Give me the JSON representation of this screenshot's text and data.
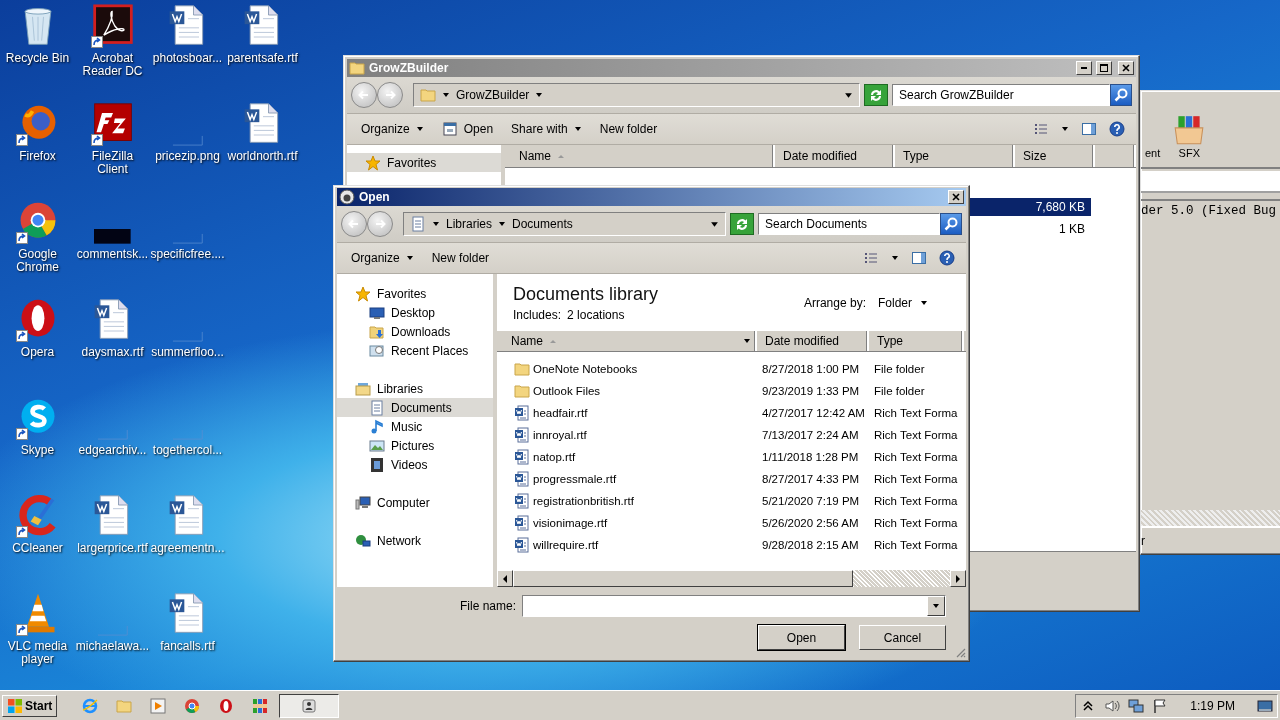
{
  "desktop_icons": [
    {
      "label": "Recycle Bin",
      "kind": "recycle",
      "shortcut": false
    },
    {
      "label": "Firefox",
      "kind": "firefox",
      "shortcut": true
    },
    {
      "label": "Google Chrome",
      "kind": "chrome",
      "shortcut": true
    },
    {
      "label": "Opera",
      "kind": "opera",
      "shortcut": true
    },
    {
      "label": "Skype",
      "kind": "skype",
      "shortcut": true
    },
    {
      "label": "CCleaner",
      "kind": "ccleaner",
      "shortcut": true
    },
    {
      "label": "VLC media player",
      "kind": "vlc",
      "shortcut": true
    },
    {
      "label": "Acrobat Reader DC",
      "kind": "acrobat",
      "shortcut": true
    },
    {
      "label": "FileZilla Client",
      "kind": "filezilla",
      "shortcut": true
    },
    {
      "label": "commentsk...",
      "kind": "black",
      "shortcut": false
    },
    {
      "label": "daysmax.rtf",
      "kind": "word",
      "shortcut": false
    },
    {
      "label": "edgearchiv...",
      "kind": "blank",
      "shortcut": false
    },
    {
      "label": "largerprice.rtf",
      "kind": "word",
      "shortcut": false
    },
    {
      "label": "michaelawa...",
      "kind": "blank",
      "shortcut": false
    },
    {
      "label": "photosboar...",
      "kind": "word",
      "shortcut": false
    },
    {
      "label": "pricezip.png",
      "kind": "blank",
      "shortcut": false
    },
    {
      "label": "specificfree....",
      "kind": "blank",
      "shortcut": false
    },
    {
      "label": "summerfloo...",
      "kind": "blank",
      "shortcut": false
    },
    {
      "label": "togethercol...",
      "kind": "blank",
      "shortcut": false
    },
    {
      "label": "agreementn...",
      "kind": "word",
      "shortcut": false
    },
    {
      "label": "fancalls.rtf",
      "kind": "word",
      "shortcut": false
    },
    {
      "label": "parentsafe.rtf",
      "kind": "word",
      "shortcut": false
    },
    {
      "label": "worldnorth.rtf",
      "kind": "word",
      "shortcut": false
    }
  ],
  "archiver_window": {
    "toolbar": [
      {
        "label": "ent",
        "kind": "cut"
      },
      {
        "label": "SFX",
        "kind": "archive"
      }
    ],
    "text": "der 5.0 (Fixed Bug",
    "status": "r"
  },
  "explorer": {
    "title": "GrowZBuilder",
    "path": [
      "GrowZBuilder"
    ],
    "search_placeholder": "Search GrowZBuilder",
    "toolbar": [
      {
        "label": "Organize",
        "kind": "menu"
      },
      {
        "label": "Open",
        "kind": "open"
      },
      {
        "label": "Share with",
        "kind": "menu"
      },
      {
        "label": "New folder",
        "kind": "plain"
      }
    ],
    "nav": [
      {
        "label": "Favorites",
        "kind": "star",
        "selected": true
      }
    ],
    "columns": [
      "Name",
      "Date modified",
      "Type",
      "Size"
    ],
    "rows": [
      {
        "size": "7,680 KB",
        "selected": true
      },
      {
        "size": "1 KB",
        "selected": false
      }
    ]
  },
  "dialog": {
    "title": "Open",
    "path": [
      "Libraries",
      "Documents"
    ],
    "search_placeholder": "Search Documents",
    "toolbar": [
      {
        "label": "Organize",
        "kind": "menu"
      },
      {
        "label": "New folder",
        "kind": "plain"
      }
    ],
    "nav": [
      {
        "label": "Favorites",
        "kind": "star",
        "selected": false,
        "children": [
          {
            "label": "Desktop",
            "kind": "desktop",
            "selected": false
          },
          {
            "label": "Downloads",
            "kind": "downloads",
            "selected": false
          },
          {
            "label": "Recent Places",
            "kind": "recent",
            "selected": false
          }
        ]
      },
      {
        "label": "Libraries",
        "kind": "libraries",
        "selected": false,
        "children": [
          {
            "label": "Documents",
            "kind": "documents",
            "selected": true
          },
          {
            "label": "Music",
            "kind": "music",
            "selected": false
          },
          {
            "label": "Pictures",
            "kind": "pictures",
            "selected": false
          },
          {
            "label": "Videos",
            "kind": "videos",
            "selected": false
          }
        ]
      },
      {
        "label": "Computer",
        "kind": "computer",
        "selected": false
      },
      {
        "label": "Network",
        "kind": "network",
        "selected": false
      }
    ],
    "library_title": "Documents library",
    "includes_label": "Includes:",
    "includes_value": "2 locations",
    "arrange_label": "Arrange by:",
    "arrange_value": "Folder",
    "columns": [
      "Name",
      "Date modified",
      "Type"
    ],
    "rows": [
      {
        "name": "OneNote Notebooks",
        "date": "8/27/2018 1:00 PM",
        "type": "File folder",
        "kind": "folder"
      },
      {
        "name": "Outlook Files",
        "date": "9/23/2019 1:33 PM",
        "type": "File folder",
        "kind": "folder"
      },
      {
        "name": "headfair.rtf",
        "date": "4/27/2017 12:42 AM",
        "type": "Rich Text Forma",
        "kind": "rtf"
      },
      {
        "name": "innroyal.rtf",
        "date": "7/13/2017 2:24 AM",
        "type": "Rich Text Forma",
        "kind": "rtf"
      },
      {
        "name": "natop.rtf",
        "date": "1/11/2018 1:28 PM",
        "type": "Rich Text Forma",
        "kind": "rtf"
      },
      {
        "name": "progressmale.rtf",
        "date": "8/27/2017 4:33 PM",
        "type": "Rich Text Forma",
        "kind": "rtf"
      },
      {
        "name": "registrationbritish.rtf",
        "date": "5/21/2020 7:19 PM",
        "type": "Rich Text Forma",
        "kind": "rtf"
      },
      {
        "name": "visionimage.rtf",
        "date": "5/26/2020 2:56 AM",
        "type": "Rich Text Forma",
        "kind": "rtf"
      },
      {
        "name": "willrequire.rtf",
        "date": "9/28/2018 2:15 AM",
        "type": "Rich Text Forma",
        "kind": "rtf"
      }
    ],
    "file_name_label": "File name:",
    "buttons": [
      "Open",
      "Cancel"
    ]
  },
  "taskbar": {
    "start": "Start",
    "items": [
      {
        "kind": "ie",
        "active": false
      },
      {
        "kind": "folder",
        "active": false
      },
      {
        "kind": "media",
        "active": false
      },
      {
        "kind": "chrome",
        "active": false
      },
      {
        "kind": "opera",
        "active": false
      },
      {
        "kind": "archive",
        "active": false
      },
      {
        "kind": "program",
        "active": true
      }
    ],
    "clock": "1:19 PM"
  }
}
